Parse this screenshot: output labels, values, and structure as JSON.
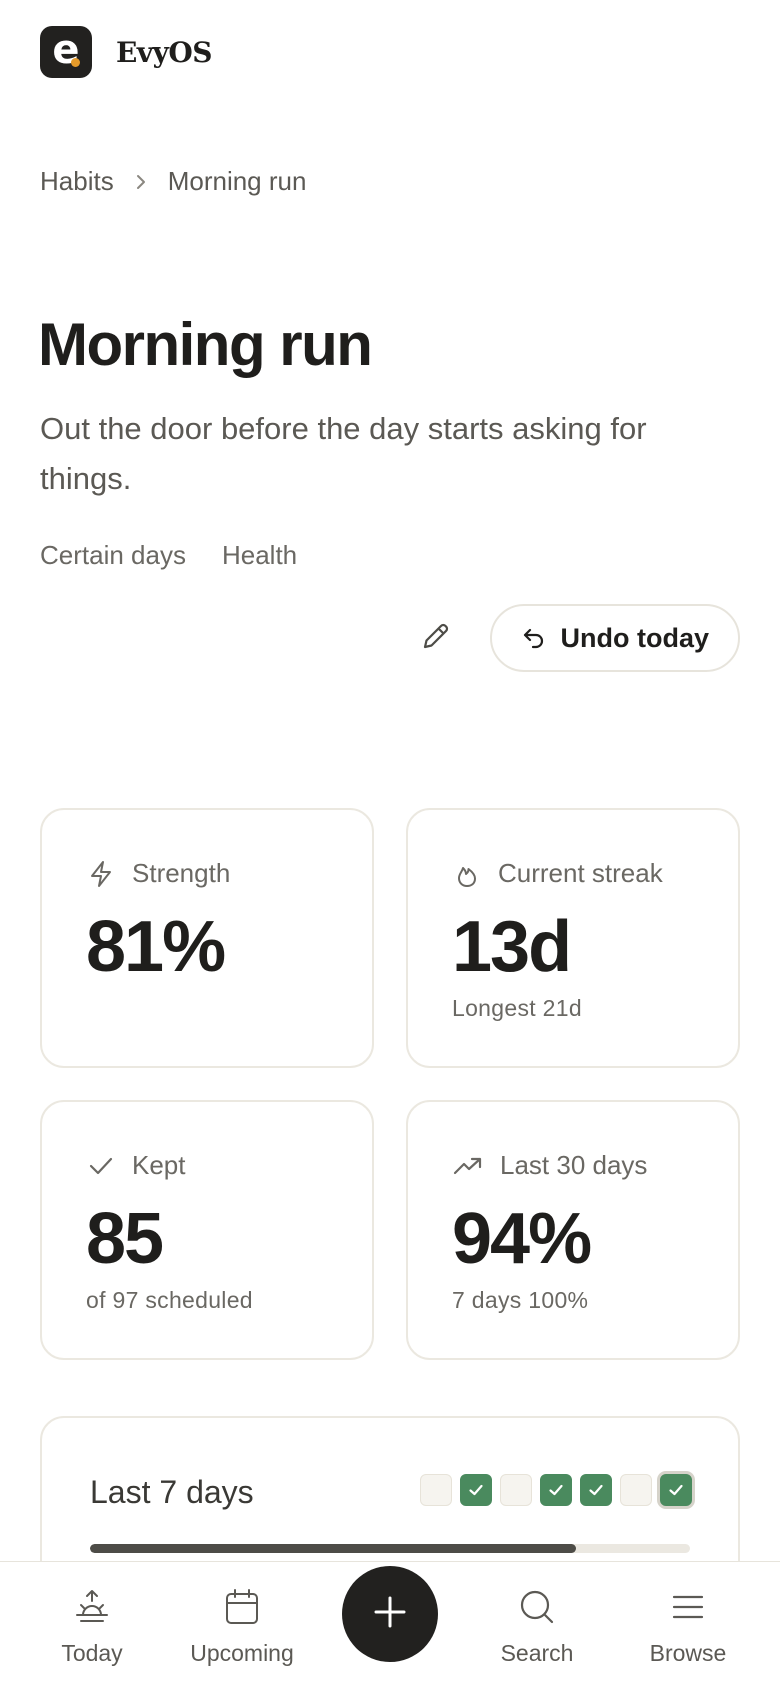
{
  "app": {
    "logo_letter": "e",
    "brand_name": "EvyOS",
    "accent_color": "#e49a2a"
  },
  "breadcrumb": {
    "parent": "Habits",
    "current": "Morning run"
  },
  "habit": {
    "title": "Morning run",
    "description": "Out the door before the day starts asking for things.",
    "tags": [
      "Certain days",
      "Health"
    ]
  },
  "actions": {
    "edit_icon": "pencil-icon",
    "undo_label": "Undo today",
    "undo_icon": "undo-arrow-icon"
  },
  "stats": {
    "strength": {
      "label": "Strength",
      "value": "81%",
      "icon": "lightning-icon"
    },
    "streak": {
      "label": "Current streak",
      "value": "13d",
      "sub": "Longest 21d",
      "icon": "flame-icon"
    },
    "kept": {
      "label": "Kept",
      "value": "85",
      "sub": "of 97 scheduled",
      "icon": "check-icon"
    },
    "last30": {
      "label": "Last 30 days",
      "value": "94%",
      "sub": "7 days 100%",
      "icon": "trending-up-icon"
    }
  },
  "week": {
    "label": "Last 7 days",
    "days": [
      false,
      true,
      false,
      true,
      true,
      false,
      true
    ],
    "today_index": 6,
    "progress_fraction": 0.81,
    "done_color": "#4a8a5e"
  },
  "nav": {
    "items": [
      {
        "label": "Today",
        "icon": "sunrise-icon"
      },
      {
        "label": "Upcoming",
        "icon": "calendar-icon"
      },
      {
        "label": "Search",
        "icon": "search-icon"
      },
      {
        "label": "Browse",
        "icon": "menu-icon"
      }
    ],
    "add_icon": "plus-icon"
  }
}
